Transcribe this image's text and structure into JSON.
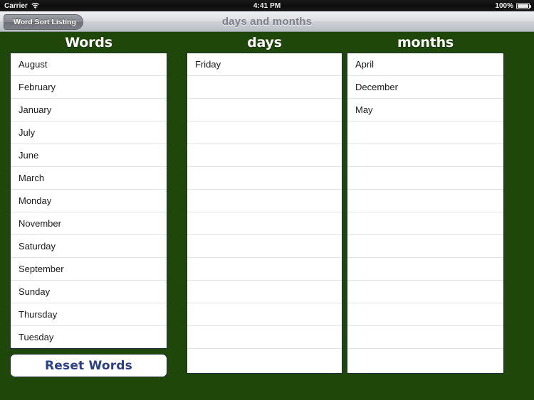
{
  "statusbar": {
    "carrier": "Carrier",
    "wifi_icon": "wifi-icon",
    "time": "4:41 PM",
    "battery_percent": "100%",
    "battery_icon": "battery-icon"
  },
  "navbar": {
    "back_label": "Word Sort Listing",
    "title": "days and months"
  },
  "theme": {
    "background_green": "#1f4709",
    "list_background": "#ffffff",
    "header_text": "#ffffff",
    "reset_text": "#2b3f84",
    "nav_title": "#7b7f87"
  },
  "columns": [
    {
      "id": "words",
      "header": "Words",
      "rows": [
        "August",
        "February",
        "January",
        "July",
        "June",
        "March",
        "Monday",
        "November",
        "Saturday",
        "September",
        "Sunday",
        "Thursday",
        "Tuesday"
      ],
      "empty_rows": 0,
      "reset_button": "Reset Words"
    },
    {
      "id": "days",
      "header": "days",
      "rows": [
        "Friday"
      ],
      "empty_rows": 13
    },
    {
      "id": "months",
      "header": "months",
      "rows": [
        "April",
        "December",
        "May"
      ],
      "empty_rows": 11
    }
  ]
}
